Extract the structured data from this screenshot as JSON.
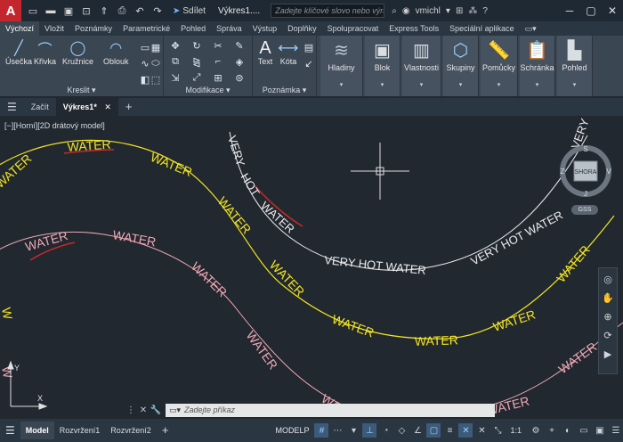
{
  "titlebar": {
    "logo": "A",
    "share_label": "Sdílet",
    "doc_title": "Výkres1....",
    "search_placeholder": "Zadejte klíčové slovo nebo výraz",
    "user": "vmichl"
  },
  "ribbon_tabs": [
    "Výchozí",
    "Vložit",
    "Poznámky",
    "Parametrické",
    "Pohled",
    "Správa",
    "Výstup",
    "Doplňky",
    "Spolupracovat",
    "Express Tools",
    "Speciální aplikace"
  ],
  "ribbon": {
    "draw": {
      "label": "Kreslit",
      "tools": [
        "Úsečka",
        "Křivka",
        "Kružnice",
        "Oblouk"
      ]
    },
    "modify": {
      "label": "Modifikace"
    },
    "annotation": {
      "label": "Poznámka",
      "tools": [
        "Text",
        "Kóta"
      ]
    },
    "big": [
      "Hladiny",
      "Blok",
      "Vlastnosti",
      "Skupiny",
      "Pomůcky",
      "Schránka",
      "Pohled"
    ]
  },
  "file_tabs": {
    "start": "Začít",
    "drawing": "Výkres1*"
  },
  "viewport": {
    "label": "[−][Horní][2D drátový model]",
    "viewcube_face": "SHORA",
    "compass": {
      "north": "S",
      "south": "J",
      "east": "V",
      "west": "Z"
    },
    "gss": "GSS"
  },
  "drawing_texts": {
    "yellow": "WATER",
    "pink": "WATER",
    "white": "VERY HOT WATER",
    "white_word_very": "VERY",
    "white_word_hot": "HOT",
    "white_word_water": "WATER"
  },
  "command": {
    "placeholder": "Zadejte příkaz"
  },
  "status": {
    "tabs": [
      "Model",
      "Rozvržení1",
      "Rozvržení2"
    ],
    "space": "MODELP",
    "scale": "1:1"
  },
  "colors": {
    "yellow": "#f2e422",
    "pink": "#f0a7b2",
    "white": "#ececec",
    "red": "#c82828",
    "bg": "#212830"
  }
}
